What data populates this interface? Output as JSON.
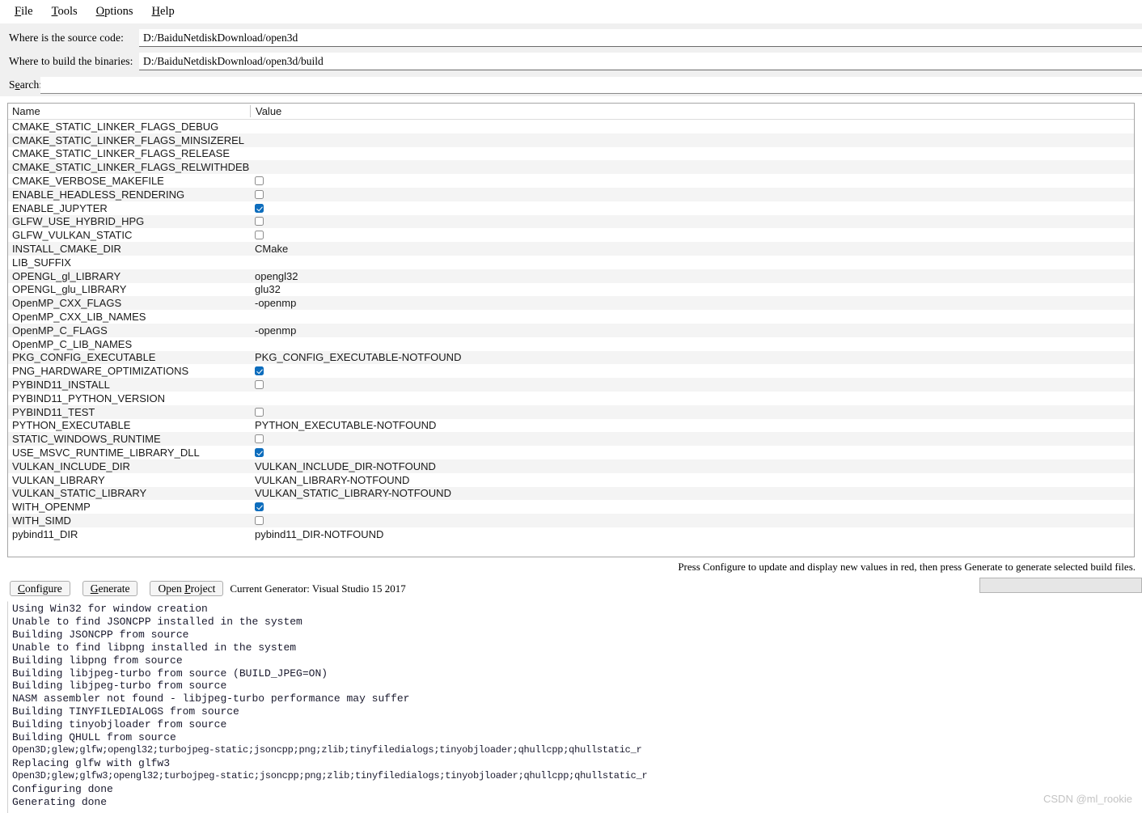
{
  "menu": {
    "items": [
      {
        "pre": "",
        "mn": "F",
        "post": "ile",
        "name": "menu-file"
      },
      {
        "pre": "",
        "mn": "T",
        "post": "ools",
        "name": "menu-tools"
      },
      {
        "pre": "",
        "mn": "O",
        "post": "ptions",
        "name": "menu-options"
      },
      {
        "pre": "",
        "mn": "H",
        "post": "elp",
        "name": "menu-help"
      }
    ]
  },
  "form": {
    "source_label": "Where is the source code:",
    "source_value": "D:/BaiduNetdiskDownload/open3d",
    "binaries_label": "Where to build the binaries:",
    "binaries_value": "D:/BaiduNetdiskDownload/open3d/build",
    "search_label_pre": "S",
    "search_label_mn": "e",
    "search_label_post": "arch:",
    "search_value": "",
    "search_placeholder": ""
  },
  "table": {
    "columns": [
      "Name",
      "Value"
    ],
    "rows": [
      {
        "name": "CMAKE_STATIC_LINKER_FLAGS_DEBUG",
        "type": "text",
        "value": ""
      },
      {
        "name": "CMAKE_STATIC_LINKER_FLAGS_MINSIZEREL",
        "type": "text",
        "value": ""
      },
      {
        "name": "CMAKE_STATIC_LINKER_FLAGS_RELEASE",
        "type": "text",
        "value": ""
      },
      {
        "name": "CMAKE_STATIC_LINKER_FLAGS_RELWITHDEBINFO",
        "type": "text",
        "value": ""
      },
      {
        "name": "CMAKE_VERBOSE_MAKEFILE",
        "type": "checkbox",
        "checked": false
      },
      {
        "name": "ENABLE_HEADLESS_RENDERING",
        "type": "checkbox",
        "checked": false
      },
      {
        "name": "ENABLE_JUPYTER",
        "type": "checkbox",
        "checked": true
      },
      {
        "name": "GLFW_USE_HYBRID_HPG",
        "type": "checkbox",
        "checked": false
      },
      {
        "name": "GLFW_VULKAN_STATIC",
        "type": "checkbox",
        "checked": false
      },
      {
        "name": "INSTALL_CMAKE_DIR",
        "type": "text",
        "value": "CMake"
      },
      {
        "name": "LIB_SUFFIX",
        "type": "text",
        "value": ""
      },
      {
        "name": "OPENGL_gl_LIBRARY",
        "type": "text",
        "value": "opengl32"
      },
      {
        "name": "OPENGL_glu_LIBRARY",
        "type": "text",
        "value": "glu32"
      },
      {
        "name": "OpenMP_CXX_FLAGS",
        "type": "text",
        "value": "-openmp"
      },
      {
        "name": "OpenMP_CXX_LIB_NAMES",
        "type": "text",
        "value": ""
      },
      {
        "name": "OpenMP_C_FLAGS",
        "type": "text",
        "value": "-openmp"
      },
      {
        "name": "OpenMP_C_LIB_NAMES",
        "type": "text",
        "value": ""
      },
      {
        "name": "PKG_CONFIG_EXECUTABLE",
        "type": "text",
        "value": "PKG_CONFIG_EXECUTABLE-NOTFOUND"
      },
      {
        "name": "PNG_HARDWARE_OPTIMIZATIONS",
        "type": "checkbox",
        "checked": true
      },
      {
        "name": "PYBIND11_INSTALL",
        "type": "checkbox",
        "checked": false
      },
      {
        "name": "PYBIND11_PYTHON_VERSION",
        "type": "text",
        "value": ""
      },
      {
        "name": "PYBIND11_TEST",
        "type": "checkbox",
        "checked": false
      },
      {
        "name": "PYTHON_EXECUTABLE",
        "type": "text",
        "value": "PYTHON_EXECUTABLE-NOTFOUND"
      },
      {
        "name": "STATIC_WINDOWS_RUNTIME",
        "type": "checkbox",
        "checked": false
      },
      {
        "name": "USE_MSVC_RUNTIME_LIBRARY_DLL",
        "type": "checkbox",
        "checked": true
      },
      {
        "name": "VULKAN_INCLUDE_DIR",
        "type": "text",
        "value": "VULKAN_INCLUDE_DIR-NOTFOUND"
      },
      {
        "name": "VULKAN_LIBRARY",
        "type": "text",
        "value": "VULKAN_LIBRARY-NOTFOUND"
      },
      {
        "name": "VULKAN_STATIC_LIBRARY",
        "type": "text",
        "value": "VULKAN_STATIC_LIBRARY-NOTFOUND"
      },
      {
        "name": "WITH_OPENMP",
        "type": "checkbox",
        "checked": true
      },
      {
        "name": "WITH_SIMD",
        "type": "checkbox",
        "checked": false
      },
      {
        "name": "pybind11_DIR",
        "type": "text",
        "value": "pybind11_DIR-NOTFOUND"
      }
    ]
  },
  "hint": "Press Configure to update and display new values in red, then press Generate to generate selected build files.",
  "buttons": {
    "configure": {
      "pre": "",
      "mn": "C",
      "post": "onfigure"
    },
    "generate": {
      "pre": "",
      "mn": "G",
      "post": "enerate"
    },
    "open_project": {
      "pre": "Open ",
      "mn": "P",
      "post": "roject"
    },
    "generator_label": "Current Generator: Visual Studio 15 2017"
  },
  "progress": {
    "percent": 0
  },
  "log": {
    "lines": [
      "Using Win32 for window creation",
      "Unable to find JSONCPP installed in the system",
      "Building JSONCPP from source",
      "Unable to find libpng installed in the system",
      "Building libpng from source",
      "Building libjpeg-turbo from source (BUILD_JPEG=ON)",
      "Building libjpeg-turbo from source",
      "NASM assembler not found - libjpeg-turbo performance may suffer",
      "Building TINYFILEDIALOGS from source",
      "Building tinyobjloader from source",
      "Building QHULL from source",
      "Open3D;glew;glfw;opengl32;turbojpeg-static;jsoncpp;png;zlib;tinyfiledialogs;tinyobjloader;qhullcpp;qhullstatic_r",
      "Replacing glfw with glfw3",
      "Open3D;glew;glfw3;opengl32;turbojpeg-static;jsoncpp;png;zlib;tinyfiledialogs;tinyobjloader;qhullcpp;qhullstatic_r",
      "Configuring done",
      "Generating done"
    ]
  },
  "watermark": "CSDN @ml_rookie",
  "colors": {
    "checkbox_checked": "#0d6dbd",
    "form_background": "#f0f0f0",
    "row_alt": "#f4f4f4"
  }
}
